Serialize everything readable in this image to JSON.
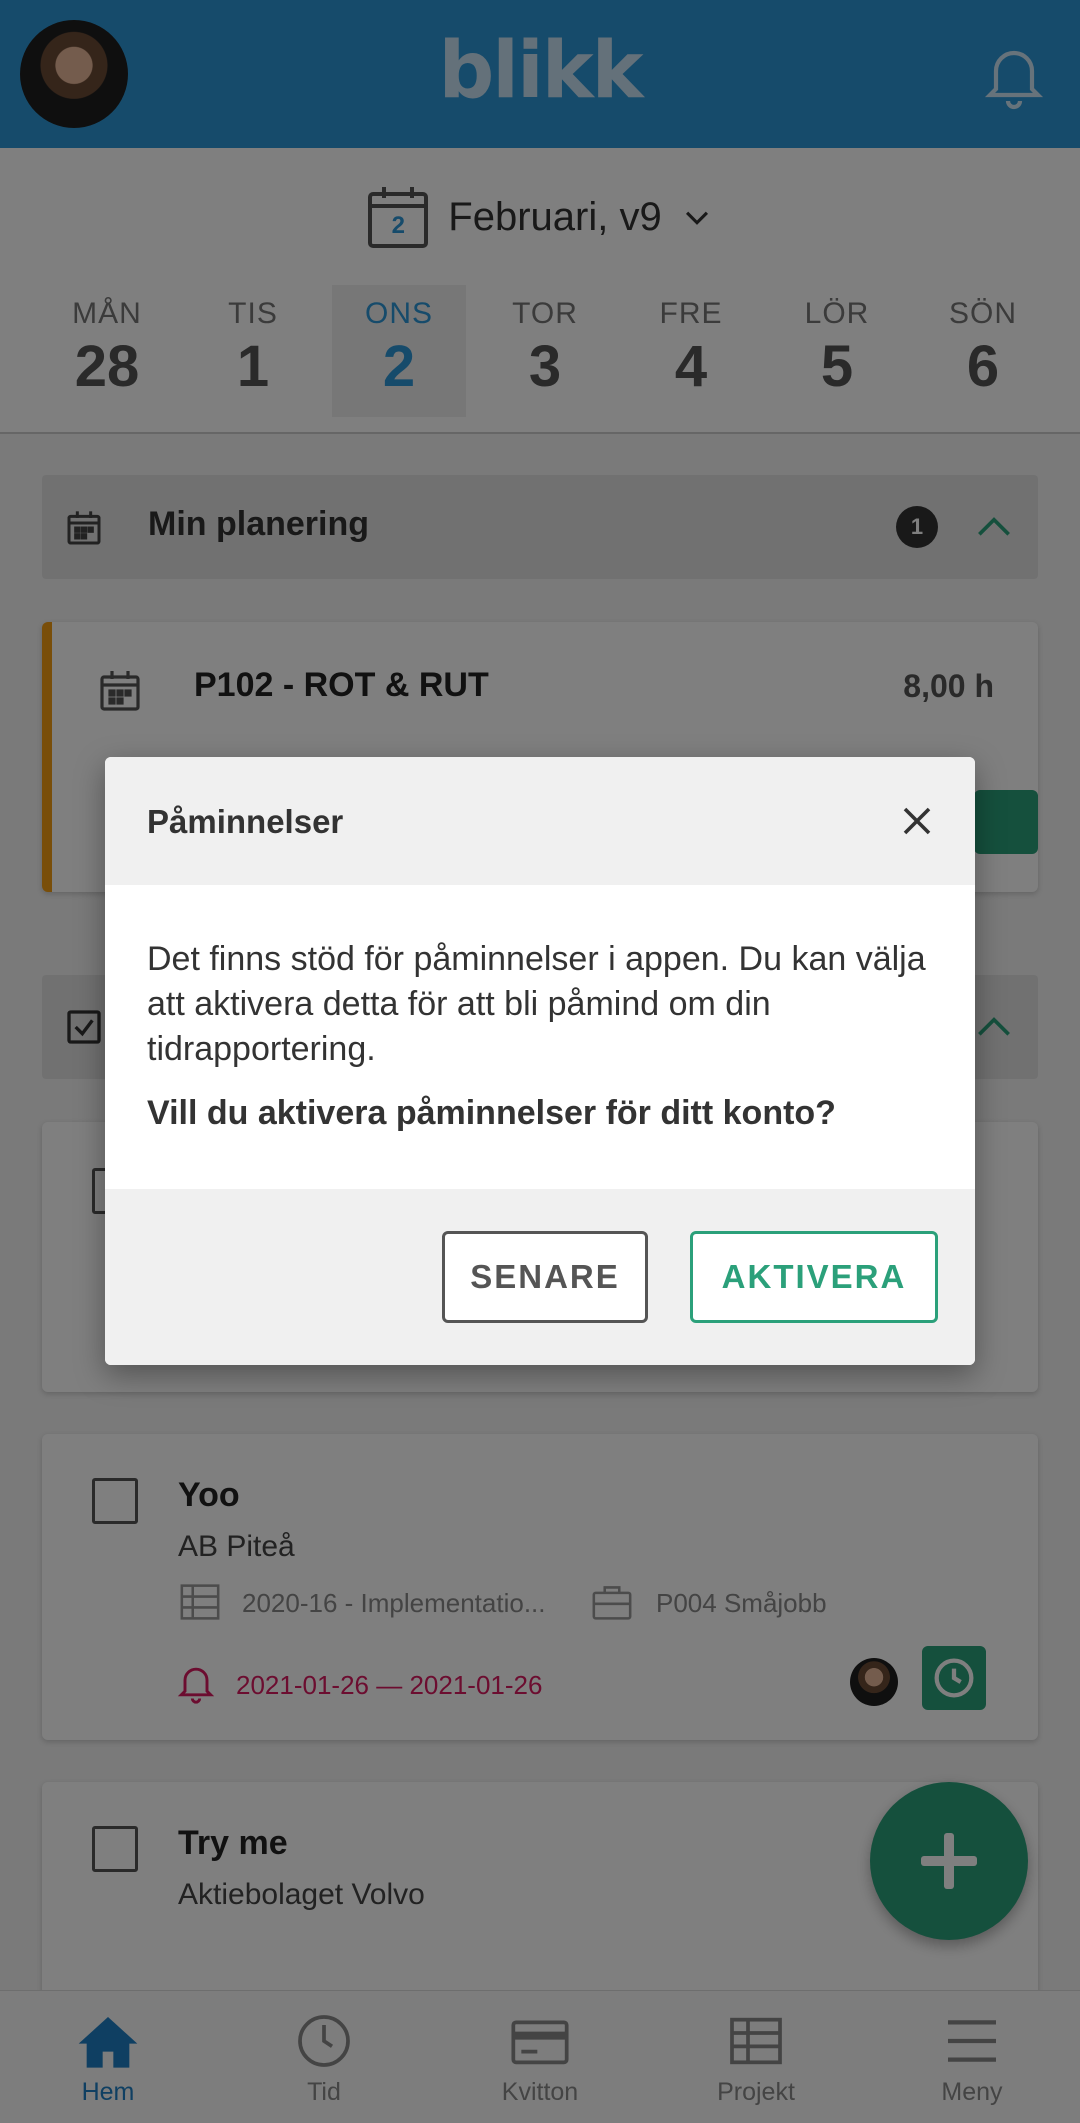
{
  "header": {
    "logo": "blikk"
  },
  "date_selector": {
    "calendar_day": "2",
    "label": "Februari, v9"
  },
  "week": [
    {
      "name": "MÅN",
      "num": "28"
    },
    {
      "name": "TIS",
      "num": "1"
    },
    {
      "name": "ONS",
      "num": "2"
    },
    {
      "name": "TOR",
      "num": "3"
    },
    {
      "name": "FRE",
      "num": "4"
    },
    {
      "name": "LÖR",
      "num": "5"
    },
    {
      "name": "SÖN",
      "num": "6"
    }
  ],
  "planning": {
    "title": "Min planering",
    "count": "1"
  },
  "planning_card": {
    "title": "P102 - ROT & RUT",
    "hours": "8,00 h"
  },
  "tasks": [
    {
      "title": "Yoo",
      "customer": "AB Piteå",
      "project": "2020-16 - Implementatio...",
      "work": "P004 Småjobb",
      "dates": "2021-01-26 — 2021-01-26"
    },
    {
      "title": "Try me",
      "customer": "Aktiebolaget Volvo"
    }
  ],
  "nav": {
    "home": "Hem",
    "time": "Tid",
    "receipts": "Kvitton",
    "projects": "Projekt",
    "menu": "Meny"
  },
  "dialog": {
    "title": "Påminnelser",
    "text": "Det finns stöd för påminnelser i appen. Du kan välja att aktivera detta för att bli påmind om din tidrapportering.",
    "question": "Vill du aktivera påminnelser för ditt konto?",
    "later": "SENARE",
    "activate": "AKTIVERA"
  },
  "colors": {
    "brand": "#2d96d6",
    "accent_green": "#2ba07a",
    "alert_red": "#d81b60",
    "planning_accent": "#f39c12"
  }
}
